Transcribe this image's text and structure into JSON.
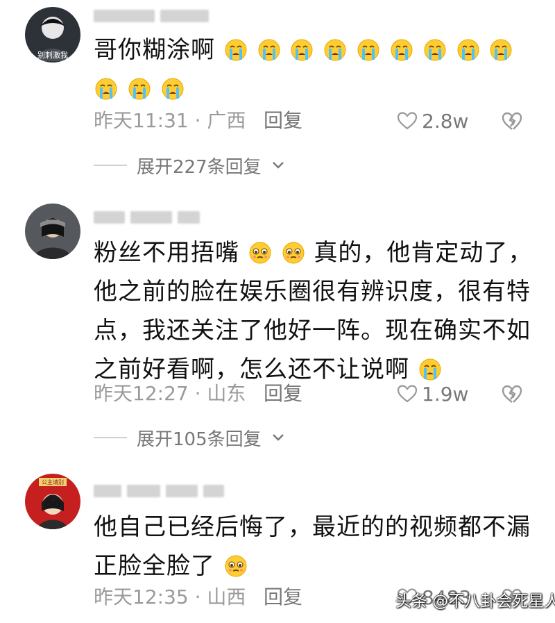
{
  "comments": [
    {
      "text_parts": [
        "哥你糊涂啊"
      ],
      "time": "昨天11:31 · 广西",
      "reply_label": "回复",
      "likes": "2.8w",
      "expand": "展开227条回复",
      "avatar_text": "别刺激我"
    },
    {
      "text_parts": [
        "粉丝不用捂嘴",
        "真的，他肯定动了，他之前的脸在娱乐圈很有辨识度，很有特点，我还关注了他好一阵。现在确实不如之前好看啊，怎么还不让说啊"
      ],
      "time": "昨天12:27 · 山东",
      "reply_label": "回复",
      "likes": "1.9w",
      "expand": "展开105条回复"
    },
    {
      "text_parts": [
        "他自己已经后悔了，最近的的视频都不漏正脸全脸了"
      ],
      "time": "昨天12:35 · 山西",
      "reply_label": "回复",
      "likes": "8483",
      "avatar_text": "公主请别"
    }
  ],
  "watermark": "头条 @不八卦会死星人",
  "icons": {
    "emoji_crying": "loudly-crying-face",
    "emoji_pleading": "pleading-face",
    "like": "heart-outline-icon",
    "dislike": "broken-heart-icon",
    "expand": "chevron-down-icon"
  },
  "colors": {
    "text": "#111111",
    "meta": "#9a9a9a",
    "reply": "#777777"
  }
}
